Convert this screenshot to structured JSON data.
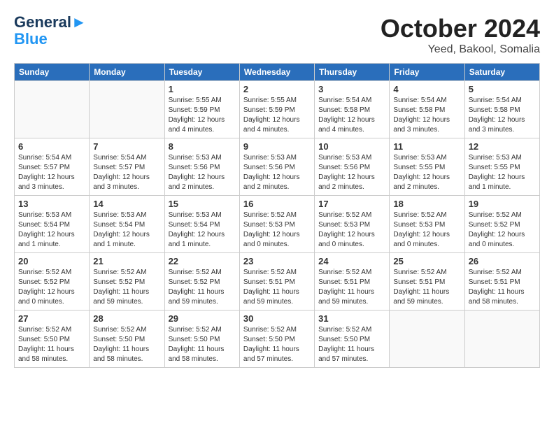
{
  "header": {
    "logo_line1": "General",
    "logo_line2": "Blue",
    "month": "October 2024",
    "location": "Yeed, Bakool, Somalia"
  },
  "weekdays": [
    "Sunday",
    "Monday",
    "Tuesday",
    "Wednesday",
    "Thursday",
    "Friday",
    "Saturday"
  ],
  "weeks": [
    [
      {
        "day": "",
        "info": ""
      },
      {
        "day": "",
        "info": ""
      },
      {
        "day": "1",
        "info": "Sunrise: 5:55 AM\nSunset: 5:59 PM\nDaylight: 12 hours\nand 4 minutes."
      },
      {
        "day": "2",
        "info": "Sunrise: 5:55 AM\nSunset: 5:59 PM\nDaylight: 12 hours\nand 4 minutes."
      },
      {
        "day": "3",
        "info": "Sunrise: 5:54 AM\nSunset: 5:58 PM\nDaylight: 12 hours\nand 4 minutes."
      },
      {
        "day": "4",
        "info": "Sunrise: 5:54 AM\nSunset: 5:58 PM\nDaylight: 12 hours\nand 3 minutes."
      },
      {
        "day": "5",
        "info": "Sunrise: 5:54 AM\nSunset: 5:58 PM\nDaylight: 12 hours\nand 3 minutes."
      }
    ],
    [
      {
        "day": "6",
        "info": "Sunrise: 5:54 AM\nSunset: 5:57 PM\nDaylight: 12 hours\nand 3 minutes."
      },
      {
        "day": "7",
        "info": "Sunrise: 5:54 AM\nSunset: 5:57 PM\nDaylight: 12 hours\nand 3 minutes."
      },
      {
        "day": "8",
        "info": "Sunrise: 5:53 AM\nSunset: 5:56 PM\nDaylight: 12 hours\nand 2 minutes."
      },
      {
        "day": "9",
        "info": "Sunrise: 5:53 AM\nSunset: 5:56 PM\nDaylight: 12 hours\nand 2 minutes."
      },
      {
        "day": "10",
        "info": "Sunrise: 5:53 AM\nSunset: 5:56 PM\nDaylight: 12 hours\nand 2 minutes."
      },
      {
        "day": "11",
        "info": "Sunrise: 5:53 AM\nSunset: 5:55 PM\nDaylight: 12 hours\nand 2 minutes."
      },
      {
        "day": "12",
        "info": "Sunrise: 5:53 AM\nSunset: 5:55 PM\nDaylight: 12 hours\nand 1 minute."
      }
    ],
    [
      {
        "day": "13",
        "info": "Sunrise: 5:53 AM\nSunset: 5:54 PM\nDaylight: 12 hours\nand 1 minute."
      },
      {
        "day": "14",
        "info": "Sunrise: 5:53 AM\nSunset: 5:54 PM\nDaylight: 12 hours\nand 1 minute."
      },
      {
        "day": "15",
        "info": "Sunrise: 5:53 AM\nSunset: 5:54 PM\nDaylight: 12 hours\nand 1 minute."
      },
      {
        "day": "16",
        "info": "Sunrise: 5:52 AM\nSunset: 5:53 PM\nDaylight: 12 hours\nand 0 minutes."
      },
      {
        "day": "17",
        "info": "Sunrise: 5:52 AM\nSunset: 5:53 PM\nDaylight: 12 hours\nand 0 minutes."
      },
      {
        "day": "18",
        "info": "Sunrise: 5:52 AM\nSunset: 5:53 PM\nDaylight: 12 hours\nand 0 minutes."
      },
      {
        "day": "19",
        "info": "Sunrise: 5:52 AM\nSunset: 5:52 PM\nDaylight: 12 hours\nand 0 minutes."
      }
    ],
    [
      {
        "day": "20",
        "info": "Sunrise: 5:52 AM\nSunset: 5:52 PM\nDaylight: 12 hours\nand 0 minutes."
      },
      {
        "day": "21",
        "info": "Sunrise: 5:52 AM\nSunset: 5:52 PM\nDaylight: 11 hours\nand 59 minutes."
      },
      {
        "day": "22",
        "info": "Sunrise: 5:52 AM\nSunset: 5:52 PM\nDaylight: 11 hours\nand 59 minutes."
      },
      {
        "day": "23",
        "info": "Sunrise: 5:52 AM\nSunset: 5:51 PM\nDaylight: 11 hours\nand 59 minutes."
      },
      {
        "day": "24",
        "info": "Sunrise: 5:52 AM\nSunset: 5:51 PM\nDaylight: 11 hours\nand 59 minutes."
      },
      {
        "day": "25",
        "info": "Sunrise: 5:52 AM\nSunset: 5:51 PM\nDaylight: 11 hours\nand 59 minutes."
      },
      {
        "day": "26",
        "info": "Sunrise: 5:52 AM\nSunset: 5:51 PM\nDaylight: 11 hours\nand 58 minutes."
      }
    ],
    [
      {
        "day": "27",
        "info": "Sunrise: 5:52 AM\nSunset: 5:50 PM\nDaylight: 11 hours\nand 58 minutes."
      },
      {
        "day": "28",
        "info": "Sunrise: 5:52 AM\nSunset: 5:50 PM\nDaylight: 11 hours\nand 58 minutes."
      },
      {
        "day": "29",
        "info": "Sunrise: 5:52 AM\nSunset: 5:50 PM\nDaylight: 11 hours\nand 58 minutes."
      },
      {
        "day": "30",
        "info": "Sunrise: 5:52 AM\nSunset: 5:50 PM\nDaylight: 11 hours\nand 57 minutes."
      },
      {
        "day": "31",
        "info": "Sunrise: 5:52 AM\nSunset: 5:50 PM\nDaylight: 11 hours\nand 57 minutes."
      },
      {
        "day": "",
        "info": ""
      },
      {
        "day": "",
        "info": ""
      }
    ]
  ]
}
